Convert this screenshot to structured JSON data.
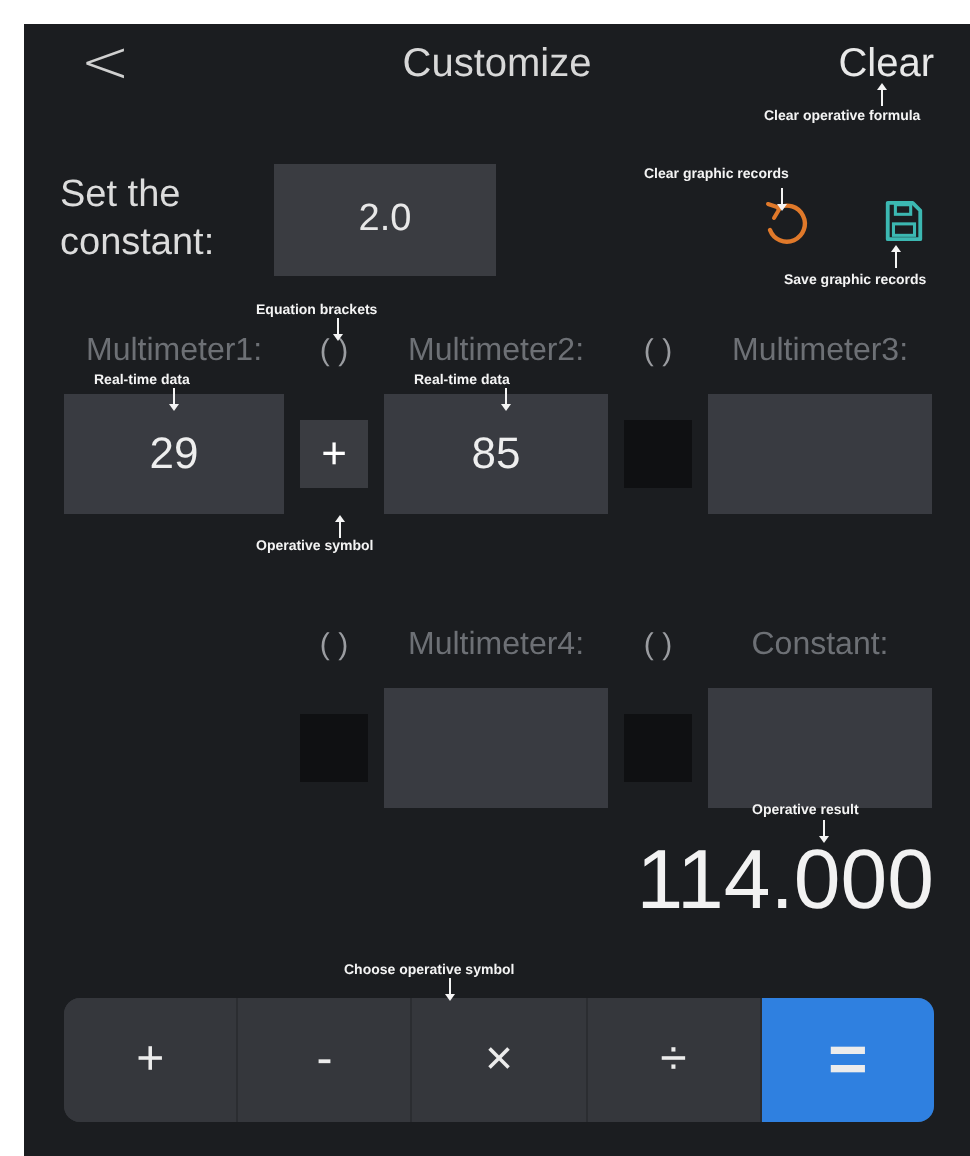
{
  "header": {
    "back": "<",
    "title": "Customize",
    "clear": "Clear"
  },
  "constant": {
    "label": "Set the constant:",
    "value": "2.0"
  },
  "rows": [
    {
      "cells": [
        {
          "kind": "operand",
          "label": "Multimeter1:",
          "value": "29"
        },
        {
          "kind": "operator",
          "bracket": "( )",
          "symbol": "+"
        },
        {
          "kind": "operand",
          "label": "Multimeter2:",
          "value": "85"
        },
        {
          "kind": "operator",
          "bracket": "( )"
        },
        {
          "kind": "operand",
          "label": "Multimeter3:"
        }
      ]
    },
    {
      "cells": [
        {
          "kind": "empty"
        },
        {
          "kind": "operator",
          "bracket": "( )"
        },
        {
          "kind": "operand",
          "label": "Multimeter4:"
        },
        {
          "kind": "operator",
          "bracket": "( )"
        },
        {
          "kind": "operand",
          "label": "Constant:"
        }
      ]
    }
  ],
  "result": "114.000",
  "keys": [
    {
      "label": "+",
      "selected": false
    },
    {
      "label": "-",
      "selected": false
    },
    {
      "label": "×",
      "selected": false
    },
    {
      "label": "÷",
      "selected": false
    },
    {
      "label": "=",
      "selected": true
    }
  ],
  "annotations": [
    {
      "kind": "clear",
      "text": "Clear operative formula"
    },
    {
      "kind": "undo",
      "text": "Clear graphic records"
    },
    {
      "kind": "save",
      "text": "Save graphic records"
    },
    {
      "kind": "bracket",
      "text": "Equation brackets"
    },
    {
      "kind": "data1",
      "text": "Real-time data"
    },
    {
      "kind": "data2",
      "text": "Real-time data"
    },
    {
      "kind": "operator",
      "text": "Operative symbol"
    },
    {
      "kind": "result",
      "text": "Operative result"
    },
    {
      "kind": "choose",
      "text": "Choose operative symbol"
    }
  ]
}
